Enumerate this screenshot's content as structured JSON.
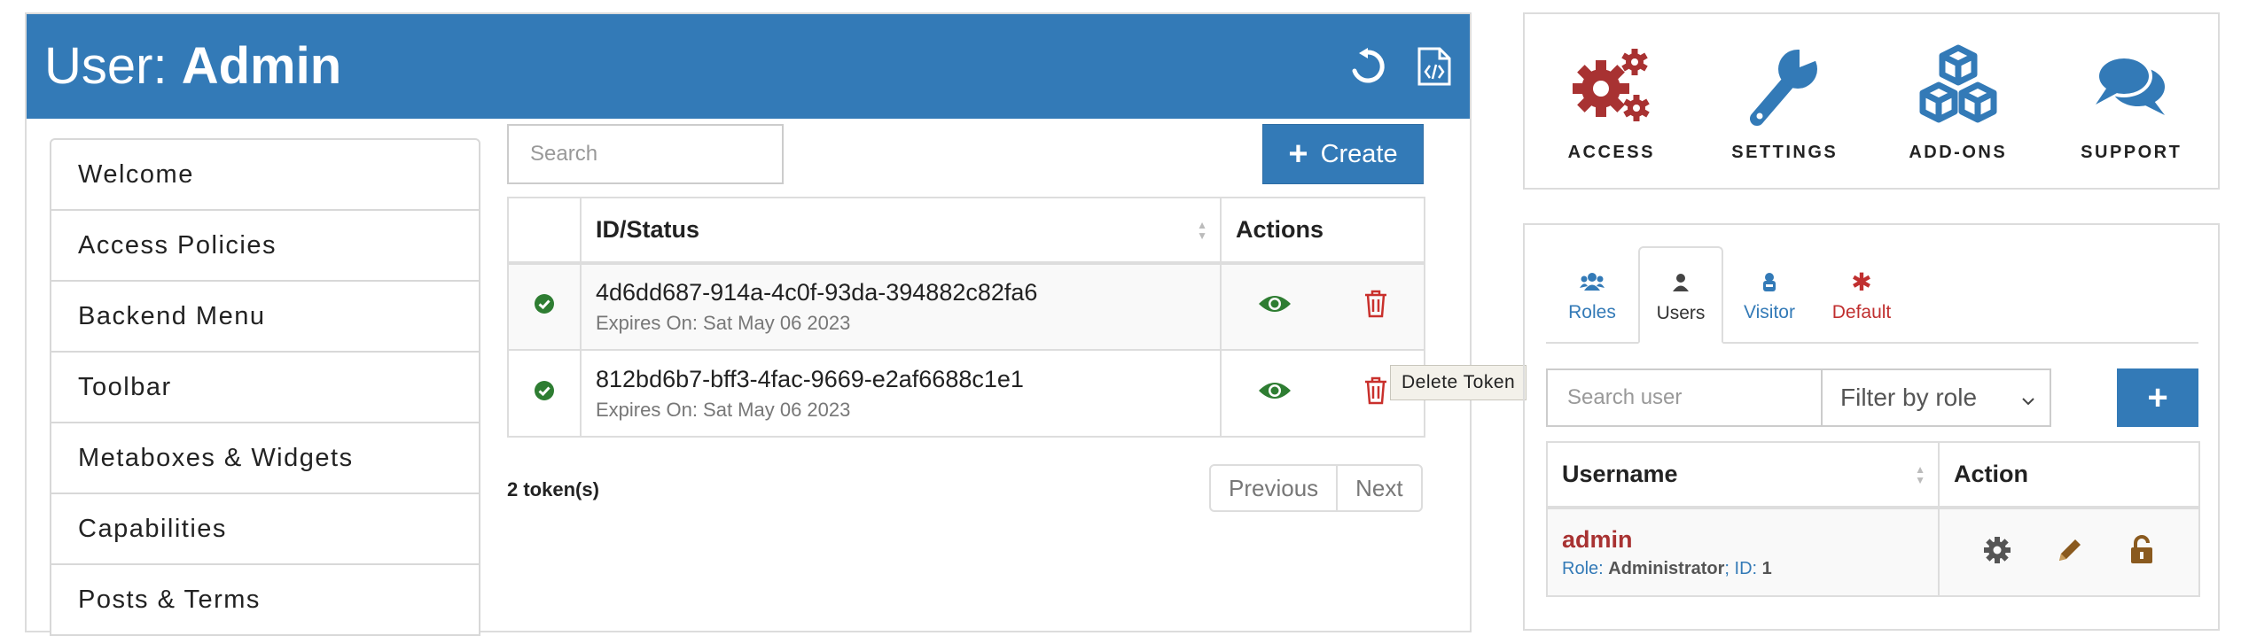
{
  "header": {
    "title_prefix": "User:",
    "title_name": "Admin",
    "icons": [
      "reset-icon",
      "export-json-icon"
    ]
  },
  "menu": {
    "items": [
      {
        "label": "Welcome"
      },
      {
        "label": "Access Policies"
      },
      {
        "label": "Backend Menu"
      },
      {
        "label": "Toolbar"
      },
      {
        "label": "Metaboxes & Widgets"
      },
      {
        "label": "Capabilities"
      },
      {
        "label": "Posts & Terms"
      }
    ]
  },
  "tokens": {
    "search_placeholder": "Search",
    "create_label": "Create",
    "columns": {
      "id_status": "ID/Status",
      "actions": "Actions"
    },
    "rows": [
      {
        "id": "4d6dd687-914a-4c0f-93da-394882c82fa6",
        "expires": "Expires On: Sat May 06 2023",
        "status": "active"
      },
      {
        "id": "812bd6b7-bff3-4fac-9669-e2af6688c1e1",
        "expires": "Expires On: Sat May 06 2023",
        "status": "active"
      }
    ],
    "tooltip": "Delete Token",
    "count_label": "2 token(s)",
    "pager": {
      "previous": "Previous",
      "next": "Next"
    }
  },
  "features": [
    {
      "label": "ACCESS",
      "icon": "gears-icon",
      "color": "#a83232"
    },
    {
      "label": "SETTINGS",
      "icon": "wrench-icon",
      "color": "#337ab7"
    },
    {
      "label": "ADD-ONS",
      "icon": "cubes-icon",
      "color": "#337ab7"
    },
    {
      "label": "SUPPORT",
      "icon": "chat-bubbles-icon",
      "color": "#337ab7"
    }
  ],
  "roles_panel": {
    "tabs": [
      {
        "label": "Roles",
        "icon": "users-group-icon",
        "active": false
      },
      {
        "label": "Users",
        "icon": "user-icon",
        "active": true
      },
      {
        "label": "Visitor",
        "icon": "visitor-icon",
        "active": false
      },
      {
        "label": "Default",
        "icon": "asterisk-icon",
        "active": false
      }
    ],
    "search_placeholder": "Search user",
    "filter_value": "Filter by role",
    "add_label": "+",
    "columns": {
      "username": "Username",
      "action": "Action"
    },
    "users": [
      {
        "username": "admin",
        "role_label": "Role:",
        "role": "Administrator",
        "id_label": "ID:",
        "id": "1"
      }
    ]
  },
  "colors": {
    "primary": "#337ab7",
    "danger": "#c9302c",
    "success": "#2e7d32",
    "accent_red": "#a83232",
    "warning_brown": "#8a5a1f"
  }
}
